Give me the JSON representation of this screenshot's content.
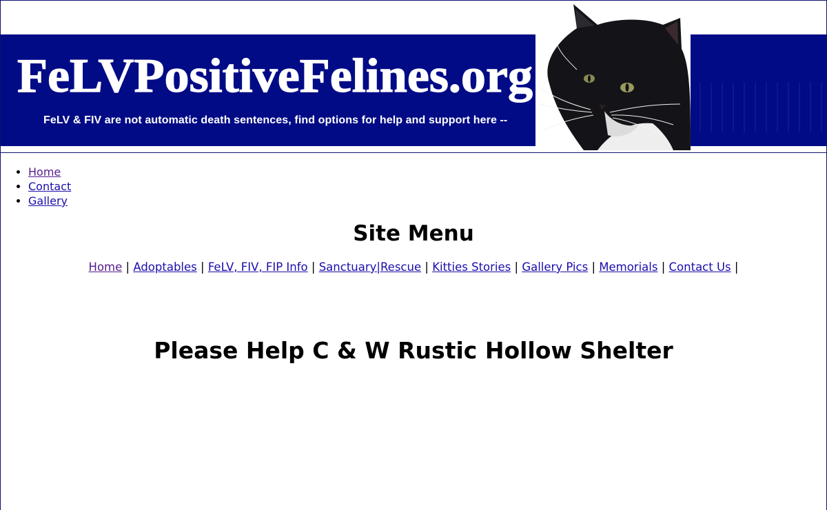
{
  "header": {
    "logo_text": "FeLVPositiveFelines.org",
    "tagline": "FeLV & FIV are not automatic death sentences, find options for help and support here --",
    "banner_color": "#020b86"
  },
  "top_nav": {
    "items": [
      {
        "label": "Home"
      },
      {
        "label": "Contact"
      },
      {
        "label": "Gallery"
      }
    ]
  },
  "site_menu": {
    "title": "Site Menu",
    "items": [
      {
        "label": "Home"
      },
      {
        "label": "Adoptables"
      },
      {
        "label": "FeLV, FIV, FIP Info"
      },
      {
        "label": "Sanctuary|Rescue"
      },
      {
        "label": "Kitties Stories"
      },
      {
        "label": "Gallery Pics"
      },
      {
        "label": "Memorials"
      },
      {
        "label": "Contact Us"
      }
    ],
    "separator": "|"
  },
  "main": {
    "heading": "Please Help C & W Rustic Hollow Shelter"
  },
  "colors": {
    "link": "#1a0dab",
    "visited_link": "#551a8b"
  }
}
